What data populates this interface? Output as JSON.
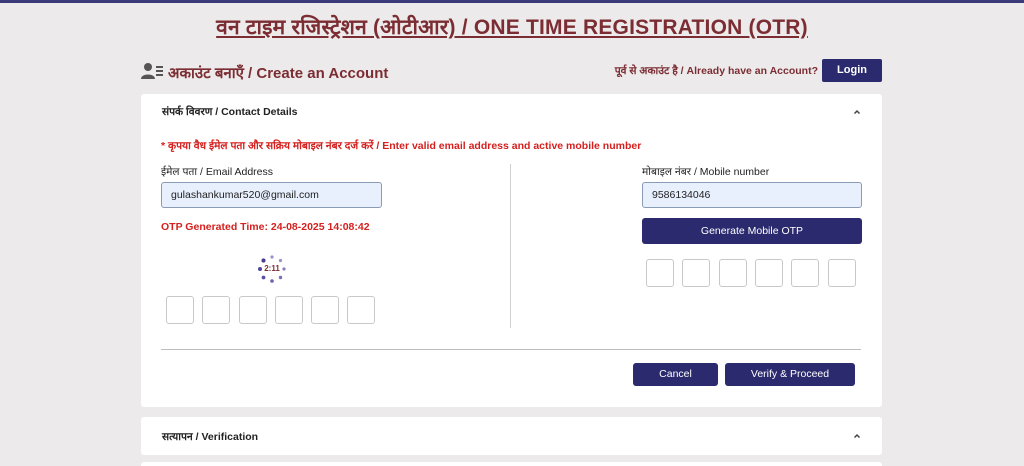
{
  "page_title": "वन टाइम रजिस्ट्रेशन (ओटीआर) / ONE TIME REGISTRATION (OTR)",
  "account": {
    "heading": "अकाउंट बनाएँ / Create an Account",
    "have_account": "पूर्व से अकाउंट है / Already have an Account?",
    "login_label": "Login",
    "icon": "user-add-icon"
  },
  "contact": {
    "title": "संपर्क विवरण / Contact Details",
    "notice": "* कृपया वैध ईमेल पता और सक्रिय मोबाइल नंबर दर्ज करें / Enter valid email address and active mobile number",
    "email_label": "ईमेल पता / Email Address",
    "email_value": "gulashankumar520@gmail.com",
    "otp_generated": "OTP Generated Time: 24-08-2025 14:08:42",
    "timer": "2:11",
    "mobile_label": "मोबाइल नंबर / Mobile number",
    "mobile_value": "9586134046",
    "generate_otp_label": "Generate Mobile OTP",
    "cancel_label": "Cancel",
    "verify_label": "Verify & Proceed"
  },
  "verification": {
    "title": "सत्यापन / Verification"
  },
  "colors": {
    "primary": "#2b2a6e",
    "title": "#7b2d33",
    "alert": "#d4201e",
    "input_bg": "#e8f0fe"
  }
}
